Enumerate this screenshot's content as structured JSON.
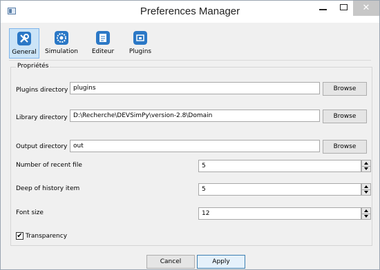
{
  "window": {
    "title": "Preferences Manager",
    "controls": {
      "minimize": "minimize",
      "maximize": "maximize",
      "close": "close"
    }
  },
  "toolbar": {
    "tabs": [
      {
        "label": "General",
        "icon": "tools-icon",
        "selected": true
      },
      {
        "label": "Simulation",
        "icon": "gear-icon",
        "selected": false
      },
      {
        "label": "Editeur",
        "icon": "editor-icon",
        "selected": false
      },
      {
        "label": "Plugins",
        "icon": "plugin-icon",
        "selected": false
      }
    ]
  },
  "group": {
    "title": "Propriétés"
  },
  "fields": {
    "plugins_dir": {
      "label": "Plugins directory",
      "value": "plugins",
      "button": "Browse"
    },
    "library_dir": {
      "label": "Library directory",
      "value": "D:\\Recherche\\DEVSimPy\\version-2.8\\Domain",
      "button": "Browse"
    },
    "output_dir": {
      "label": "Output directory",
      "value": "out",
      "button": "Browse"
    },
    "recent_files": {
      "label": "Number of recent file",
      "value": "5"
    },
    "history_depth": {
      "label": "Deep of history item",
      "value": "5"
    },
    "font_size": {
      "label": "Font size",
      "value": "12"
    },
    "transparency": {
      "label": "Transparency",
      "checked": true,
      "mark": "✔"
    }
  },
  "footer": {
    "cancel": "Cancel",
    "apply": "Apply"
  },
  "colors": {
    "selected_tab_bg": "#cbe4f7",
    "accent_border": "#3c7fb1",
    "close_button": "#c7c7c7"
  }
}
